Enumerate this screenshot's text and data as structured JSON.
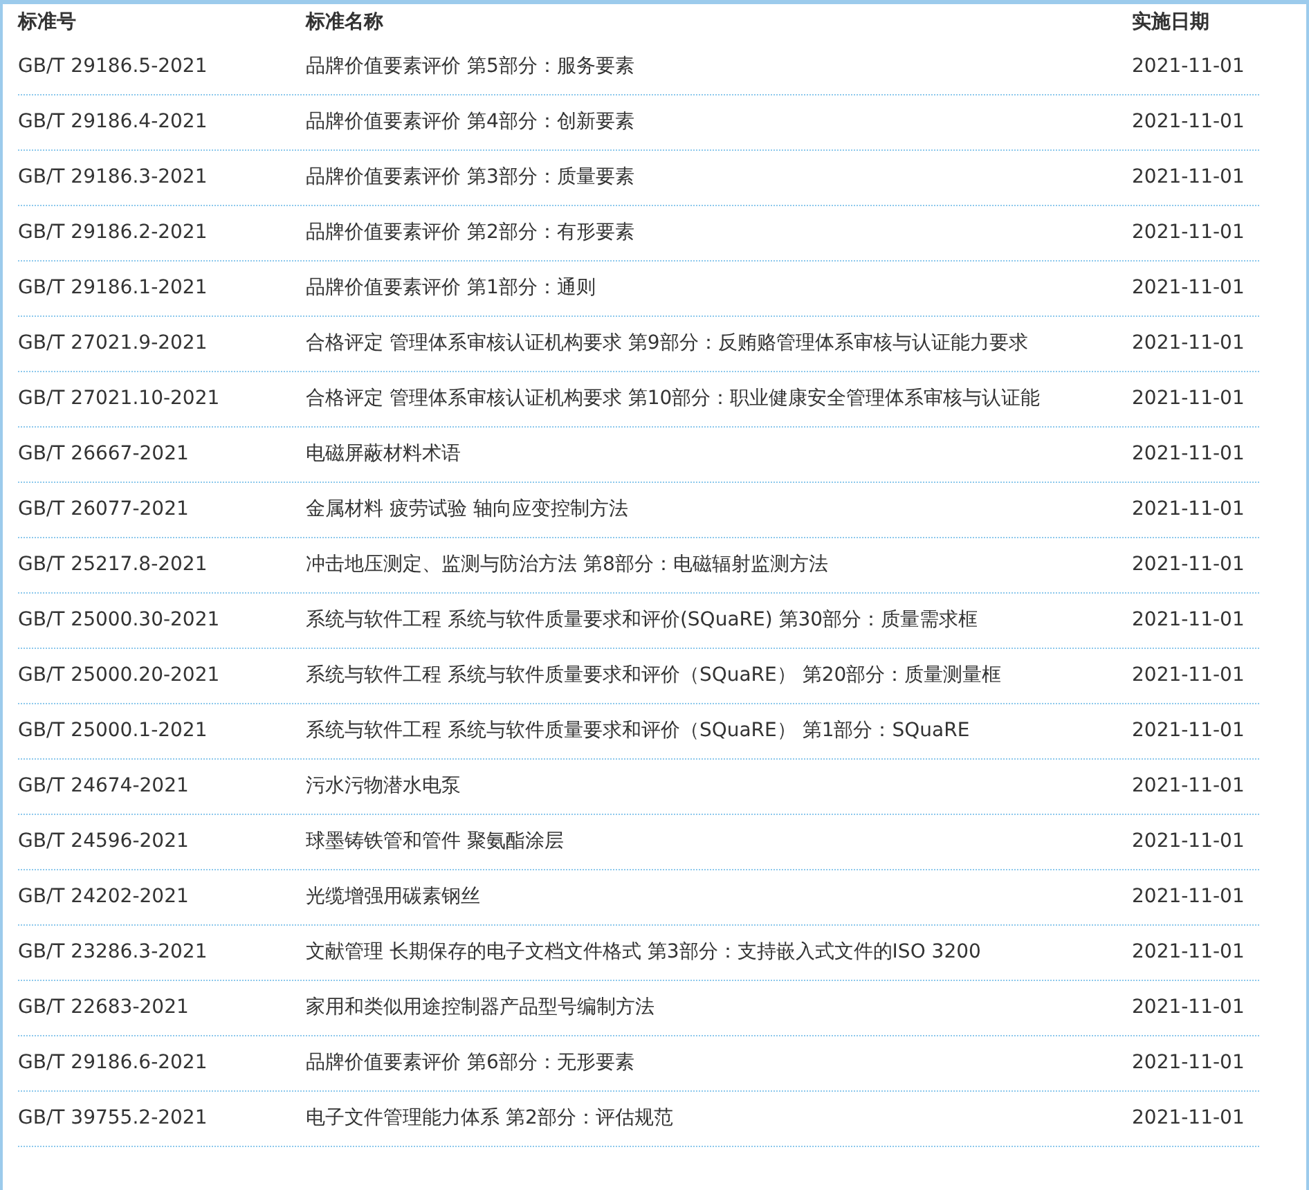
{
  "table": {
    "columns": [
      "标准号",
      "标准名称",
      "实施日期"
    ],
    "rows": [
      {
        "number": "GB/T 29186.5-2021",
        "name": "品牌价值要素评价 第5部分：服务要素",
        "date": "2021-11-01"
      },
      {
        "number": "GB/T 29186.4-2021",
        "name": "品牌价值要素评价 第4部分：创新要素",
        "date": "2021-11-01"
      },
      {
        "number": "GB/T 29186.3-2021",
        "name": "品牌价值要素评价 第3部分：质量要素",
        "date": "2021-11-01"
      },
      {
        "number": "GB/T 29186.2-2021",
        "name": "品牌价值要素评价 第2部分：有形要素",
        "date": "2021-11-01"
      },
      {
        "number": "GB/T 29186.1-2021",
        "name": "品牌价值要素评价 第1部分：通则",
        "date": "2021-11-01"
      },
      {
        "number": "GB/T 27021.9-2021",
        "name": "合格评定 管理体系审核认证机构要求 第9部分：反贿赂管理体系审核与认证能力要求",
        "date": "2021-11-01"
      },
      {
        "number": "GB/T 27021.10-2021",
        "name": "合格评定 管理体系审核认证机构要求 第10部分：职业健康安全管理体系审核与认证能",
        "date": "2021-11-01"
      },
      {
        "number": "GB/T 26667-2021",
        "name": "电磁屏蔽材料术语",
        "date": "2021-11-01"
      },
      {
        "number": "GB/T 26077-2021",
        "name": "金属材料 疲劳试验 轴向应变控制方法",
        "date": "2021-11-01"
      },
      {
        "number": "GB/T 25217.8-2021",
        "name": "冲击地压测定、监测与防治方法 第8部分：电磁辐射监测方法",
        "date": "2021-11-01"
      },
      {
        "number": "GB/T 25000.30-2021",
        "name": "系统与软件工程 系统与软件质量要求和评价(SQuaRE) 第30部分：质量需求框",
        "date": "2021-11-01"
      },
      {
        "number": "GB/T 25000.20-2021",
        "name": "系统与软件工程 系统与软件质量要求和评价（SQuaRE） 第20部分：质量测量框",
        "date": "2021-11-01"
      },
      {
        "number": "GB/T 25000.1-2021",
        "name": "系统与软件工程 系统与软件质量要求和评价（SQuaRE） 第1部分：SQuaRE",
        "date": "2021-11-01"
      },
      {
        "number": "GB/T 24674-2021",
        "name": "污水污物潜水电泵",
        "date": "2021-11-01"
      },
      {
        "number": "GB/T 24596-2021",
        "name": "球墨铸铁管和管件 聚氨酯涂层",
        "date": "2021-11-01"
      },
      {
        "number": "GB/T 24202-2021",
        "name": "光缆增强用碳素钢丝",
        "date": "2021-11-01"
      },
      {
        "number": "GB/T 23286.3-2021",
        "name": "文献管理 长期保存的电子文档文件格式 第3部分：支持嵌入式文件的ISO 3200",
        "date": "2021-11-01"
      },
      {
        "number": "GB/T 22683-2021",
        "name": "家用和类似用途控制器产品型号编制方法",
        "date": "2021-11-01"
      },
      {
        "number": "GB/T 29186.6-2021",
        "name": "品牌价值要素评价 第6部分：无形要素",
        "date": "2021-11-01"
      },
      {
        "number": "GB/T 39755.2-2021",
        "name": "电子文件管理能力体系 第2部分：评估规范",
        "date": "2021-11-01"
      }
    ]
  }
}
